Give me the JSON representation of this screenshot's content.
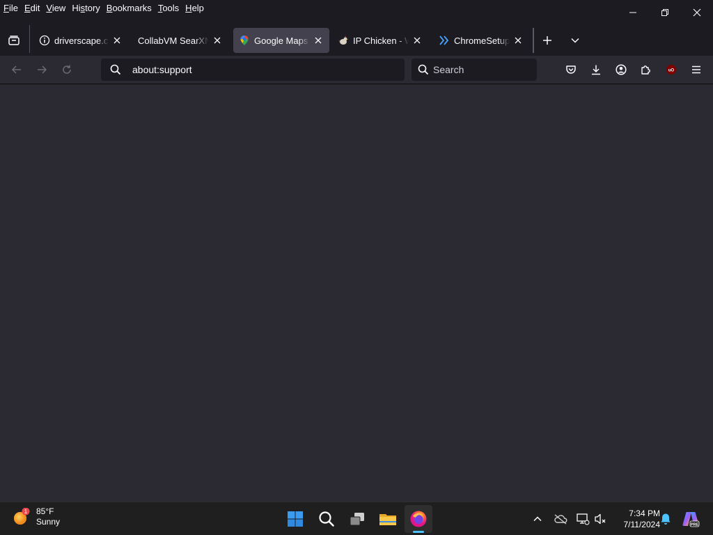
{
  "menubar": {
    "items": [
      "File",
      "Edit",
      "View",
      "History",
      "Bookmarks",
      "Tools",
      "Help"
    ],
    "mnemonics": [
      "F",
      "E",
      "V",
      "s",
      "B",
      "T",
      "H"
    ]
  },
  "tabs": [
    {
      "title": "driverscape.com",
      "favicon": "info-icon",
      "active": false
    },
    {
      "title": "CollabVM SearXNG",
      "favicon": "none",
      "active": false
    },
    {
      "title": "Google Maps",
      "favicon": "map-pin-icon",
      "active": true
    },
    {
      "title": "IP Chicken - What is my IP",
      "favicon": "chicken-icon",
      "active": false
    },
    {
      "title": "ChromeSetup.exe",
      "favicon": "double-chevron-icon",
      "active": false
    }
  ],
  "navbar": {
    "url": "about:support",
    "search_placeholder": "Search"
  },
  "taskbar": {
    "weather": {
      "temp": "85°F",
      "condition": "Sunny",
      "badge": "1"
    },
    "clock": {
      "time": "7:34 PM",
      "date": "7/11/2024"
    }
  },
  "colors": {
    "tabstrip_bg": "#1c1b22",
    "toolbar_bg": "#2b2a33",
    "active_tab_bg": "#42414d",
    "taskbar_bg": "#1f1f1f",
    "accent": "#4cc2ff"
  }
}
